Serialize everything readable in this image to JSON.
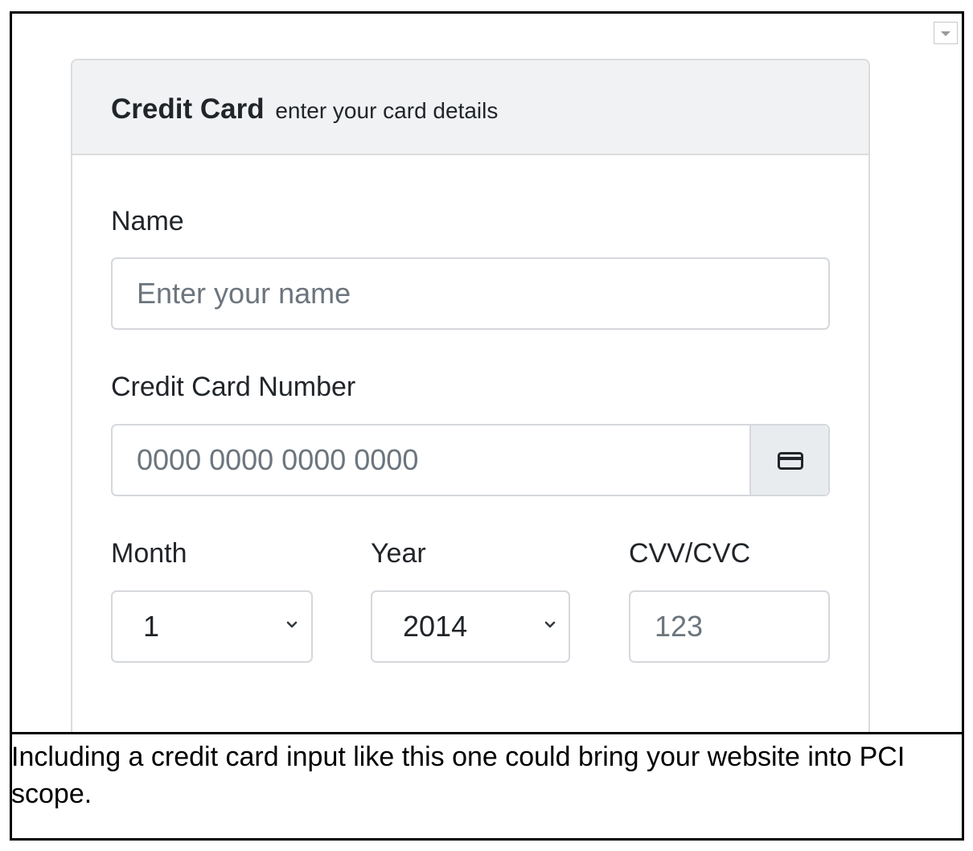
{
  "card": {
    "title": "Credit Card",
    "subtitle": "enter your card details"
  },
  "name_field": {
    "label": "Name",
    "placeholder": "Enter your name"
  },
  "number_field": {
    "label": "Credit Card Number",
    "placeholder": "0000 0000 0000 0000",
    "addon_icon": "credit-card-icon"
  },
  "month_field": {
    "label": "Month",
    "value": "1"
  },
  "year_field": {
    "label": "Year",
    "value": "2014"
  },
  "cvv_field": {
    "label": "CVV/CVC",
    "placeholder": "123"
  },
  "caption": "Including a credit card input like this one could bring your website into PCI scope.",
  "colors": {
    "header_bg": "#f1f2f4",
    "addon_bg": "#e9ecef",
    "border": "#d5d8dc",
    "placeholder": "#6c757d",
    "text": "#212529"
  }
}
